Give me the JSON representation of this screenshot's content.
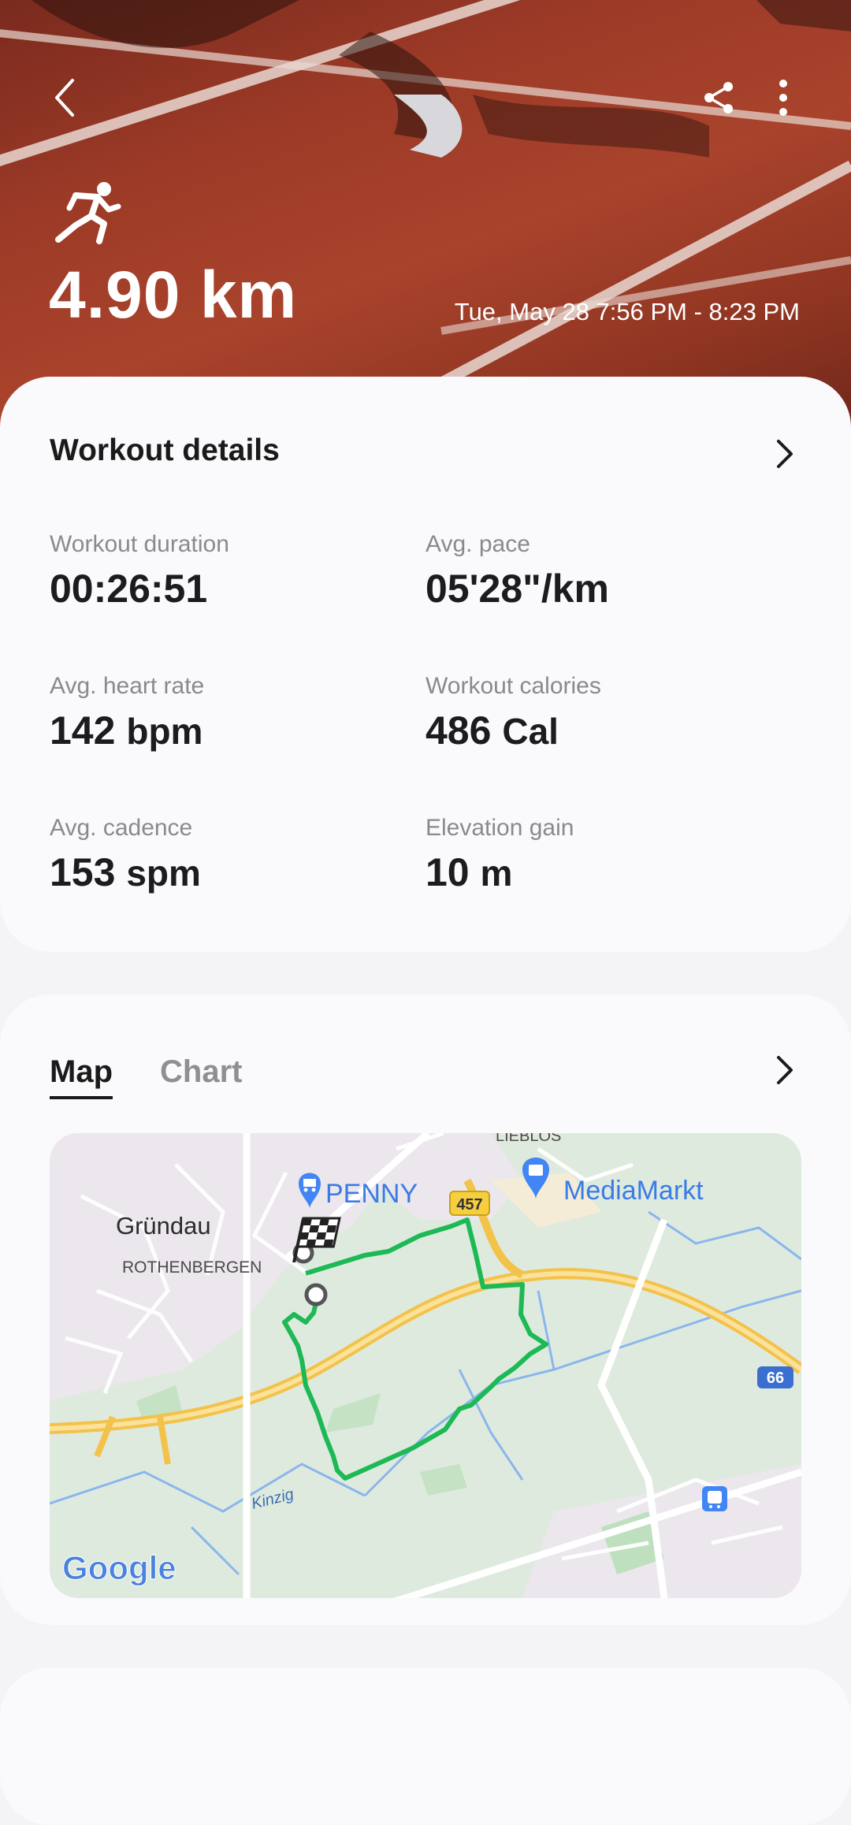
{
  "hero": {
    "distance": "4.90 km",
    "datetime": "Tue, May 28 7:56 PM - 8:23 PM",
    "back_icon": "back-arrow-icon",
    "share_icon": "share-icon",
    "more_icon": "more-vertical-icon",
    "activity_icon": "running-person-icon"
  },
  "workout_details": {
    "title": "Workout details",
    "stats": [
      {
        "label": "Workout duration",
        "value": "00:26:51",
        "unit": ""
      },
      {
        "label": "Avg. pace",
        "value": "05'28\"/km",
        "unit": ""
      },
      {
        "label": "Avg. heart rate",
        "value": "142",
        "unit": "bpm"
      },
      {
        "label": "Workout calories",
        "value": "486",
        "unit": "Cal"
      },
      {
        "label": "Avg. cadence",
        "value": "153",
        "unit": "spm"
      },
      {
        "label": "Elevation gain",
        "value": "10",
        "unit": "m"
      }
    ]
  },
  "map_section": {
    "tabs": [
      {
        "label": "Map",
        "active": true
      },
      {
        "label": "Chart",
        "active": false
      }
    ],
    "map_labels": {
      "town": "Gründau",
      "district": "ROTHENBERGEN",
      "north": "LIEBLOS",
      "store1": "PENNY",
      "store2": "MediaMarkt",
      "road1": "457",
      "road2": "66",
      "river": "Kinzig",
      "attribution": "Google"
    }
  },
  "colors": {
    "route": "#1db954",
    "accent_text": "#1a1a1a",
    "muted_text": "#8a8a8e",
    "map_poi_blue": "#4285f4",
    "road_yellow": "#f9c74f"
  }
}
